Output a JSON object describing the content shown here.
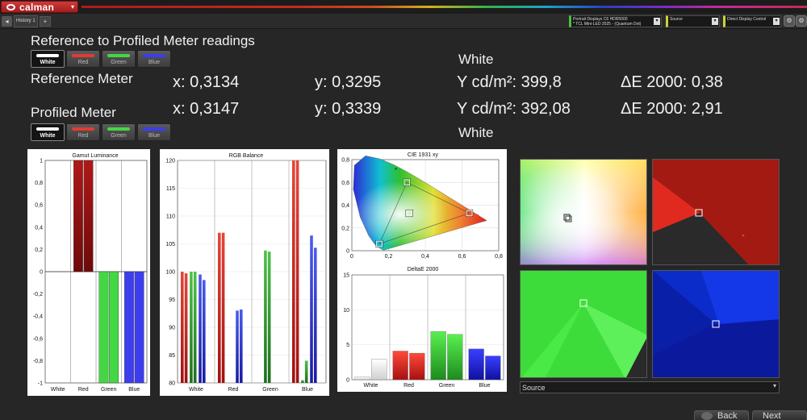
{
  "app": {
    "logo_text": "calman"
  },
  "tabs": {
    "history": "History 1",
    "add": "+"
  },
  "devices": {
    "meter_line1": "Portrait Displays C6 HDR5000",
    "meter_line2": "* TCL Mini-LED 2025 - (Quantum Dot)",
    "source": "Source",
    "display_control": "Direct Display Control"
  },
  "heading": "Reference to Profiled Meter readings",
  "swatch_labels": [
    "White",
    "Red",
    "Green",
    "Blue"
  ],
  "swatch_selected": "White",
  "reference": {
    "label": "Reference Meter",
    "x": "x: 0,3134",
    "y": "y: 0,3295",
    "Y": "Y cd/m²: 399,8",
    "de": "ΔE 2000: 0,38",
    "color_label": "White"
  },
  "profiled": {
    "label": "Profiled Meter",
    "x": "x: 0,3147",
    "y": "y: 0,3339",
    "Y": "Y cd/m²: 392,08",
    "de": "ΔE 2000: 2,91",
    "color_label": "White"
  },
  "colors": {
    "white": "#ffffff",
    "red": "#e53935",
    "green": "#43d843",
    "blue": "#3d3df0",
    "dark_red": "#8e0f0f"
  },
  "source_dropdown": {
    "value": "Source"
  },
  "nav": {
    "back": "Back",
    "next": "Next"
  },
  "chart_data": [
    {
      "id": "gamut",
      "type": "bar",
      "title": "Gamut Luminance",
      "categories": [
        "White",
        "Red",
        "Green",
        "Blue"
      ],
      "ylim": [
        -1,
        1
      ],
      "yticks": [
        "1",
        "0,8",
        "0,6",
        "0,4",
        "0,2",
        "0",
        "-0,2",
        "-0,4",
        "-0,6",
        "-0,8",
        "-1"
      ],
      "series": [
        {
          "values": [
            0,
            1,
            -1,
            -1
          ]
        },
        {
          "values": [
            0,
            1,
            -1,
            -1
          ]
        }
      ]
    },
    {
      "id": "rgb",
      "type": "bar",
      "title": "RGB Balance",
      "categories": [
        "White",
        "Red",
        "Green",
        "Blue"
      ],
      "ylim": [
        80,
        120
      ],
      "yticks": [
        "120",
        "115",
        "110",
        "105",
        "100",
        "95",
        "90",
        "85",
        "80"
      ],
      "groups": [
        {
          "r": [
            100,
            99.7
          ],
          "g": [
            100,
            100
          ],
          "b": [
            99.5,
            98.5
          ]
        },
        {
          "r": [
            107,
            107
          ],
          "g": [
            80,
            80
          ],
          "b": [
            93,
            93.2
          ]
        },
        {
          "r": [
            80,
            80
          ],
          "g": [
            103.8,
            103.6
          ],
          "b": [
            80,
            80
          ]
        },
        {
          "r": [
            120,
            120
          ],
          "g": [
            80.5,
            84
          ],
          "b": [
            106.5,
            104.3
          ]
        }
      ]
    },
    {
      "id": "cie",
      "type": "scatter",
      "title": "CIE 1931 xy",
      "xlim": [
        0,
        0.8
      ],
      "ylim": [
        0,
        0.8
      ],
      "xticks": [
        "0",
        "0,2",
        "0,4",
        "0,6",
        "0,8"
      ],
      "yticks": [
        "0",
        "0,2",
        "0,4",
        "0,6",
        "0,8"
      ],
      "targets": [
        {
          "x": 0.64,
          "y": 0.33
        },
        {
          "x": 0.3,
          "y": 0.6
        },
        {
          "x": 0.15,
          "y": 0.06
        },
        {
          "x": 0.3127,
          "y": 0.329
        }
      ]
    },
    {
      "id": "de",
      "type": "bar",
      "title": "DeltaE 2000",
      "categories": [
        "White",
        "Red",
        "Green",
        "Blue"
      ],
      "ylim": [
        0,
        15
      ],
      "yticks": [
        "15",
        "10",
        "5",
        "0"
      ],
      "pairs": [
        [
          0.38,
          2.91
        ],
        [
          4.1,
          3.8
        ],
        [
          6.9,
          6.5
        ],
        [
          4.4,
          3.4
        ]
      ]
    }
  ]
}
